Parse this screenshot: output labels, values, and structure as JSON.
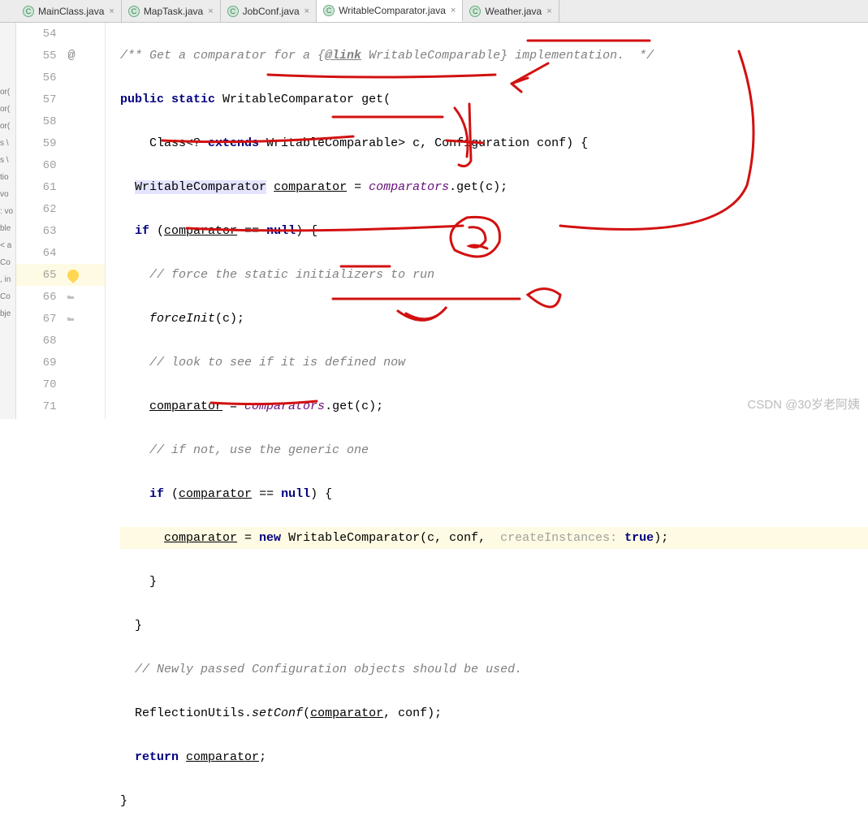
{
  "tabs": [
    {
      "label": "MainClass.java",
      "icon": "C",
      "active": false
    },
    {
      "label": "MapTask.java",
      "icon": "C",
      "active": false
    },
    {
      "label": "JobConf.java",
      "icon": "C",
      "active": false
    },
    {
      "label": "WritableComparator.java",
      "icon": "C",
      "active": true
    },
    {
      "label": "Weather.java",
      "icon": "C",
      "active": false
    }
  ],
  "sidebarSliver": [
    "or(",
    "or(",
    "or(",
    "s \\",
    "s \\",
    "tio",
    "vo",
    ": vo",
    "ble",
    "< a",
    "Co",
    ", in",
    "Co",
    "bje"
  ],
  "lines": [
    {
      "num": "54",
      "icons": []
    },
    {
      "num": "55",
      "icons": [
        "at"
      ]
    },
    {
      "num": "56",
      "icons": []
    },
    {
      "num": "57",
      "icons": []
    },
    {
      "num": "58",
      "icons": []
    },
    {
      "num": "59",
      "icons": []
    },
    {
      "num": "60",
      "icons": []
    },
    {
      "num": "61",
      "icons": []
    },
    {
      "num": "62",
      "icons": []
    },
    {
      "num": "63",
      "icons": []
    },
    {
      "num": "64",
      "icons": []
    },
    {
      "num": "65",
      "icons": [
        "bulb"
      ]
    },
    {
      "num": "66",
      "icons": [
        "mini"
      ]
    },
    {
      "num": "67",
      "icons": [
        "mini"
      ]
    },
    {
      "num": "68",
      "icons": []
    },
    {
      "num": "69",
      "icons": []
    },
    {
      "num": "70",
      "icons": []
    },
    {
      "num": "71",
      "icons": []
    }
  ],
  "code": {
    "l54_doc1": "/** Get a comparator for a {",
    "l54_link": "@link",
    "l54_doc2": " WritableComparable} implementation.  */",
    "l55_kw1": "public static ",
    "l55_type": "WritableComparator ",
    "l55_method": "get",
    "l55_paren": "(",
    "l56_text1": "Class<? ",
    "l56_kw": "extends",
    "l56_text2": " WritableComparable> c, Configuration conf) {",
    "l57_type": "WritableComparator",
    "l57_space1": " ",
    "l57_var": "comparator",
    "l57_eq": " = ",
    "l57_field": "comparators",
    "l57_call": ".get(c);",
    "l58_kw": "if",
    "l58_open": " (",
    "l58_var": "comparator",
    "l58_eqeq": " == ",
    "l58_null": "null",
    "l58_close": ") {",
    "l59_cmt": "// force the static initializers to run",
    "l60_call": "forceInit",
    "l60_arg": "(c);",
    "l61_cmt": "// look to see if it is defined now",
    "l62_var": "comparator",
    "l62_eq": " = ",
    "l62_field": "comparators",
    "l62_call": ".get(c);",
    "l63_cmt": "// if not, use the generic one",
    "l64_kw": "if",
    "l64_open": " (",
    "l64_var": "comparator",
    "l64_eqeq": " == ",
    "l64_null": "null",
    "l64_close": ") {",
    "l65_var": "comparator",
    "l65_eq": " = ",
    "l65_new": "new",
    "l65_sp": " ",
    "l65_ctor": "WritableComparator",
    "l65_args1": "(c, conf,  ",
    "l65_hint": "createInstances: ",
    "l65_true": "true",
    "l65_end": ");",
    "l66_brace": "}",
    "l67_brace": "}",
    "l68_cmt": "// Newly passed Configuration objects should be used.",
    "l69_class": "ReflectionUtils.",
    "l69_method": "setConf",
    "l69_open": "(",
    "l69_var": "comparator",
    "l69_rest": ", conf);",
    "l70_kw": "return",
    "l70_sp": " ",
    "l70_var": "comparator",
    "l70_semi": ";",
    "l71_brace": "}"
  },
  "watermark": "CSDN @30岁老阿姨"
}
